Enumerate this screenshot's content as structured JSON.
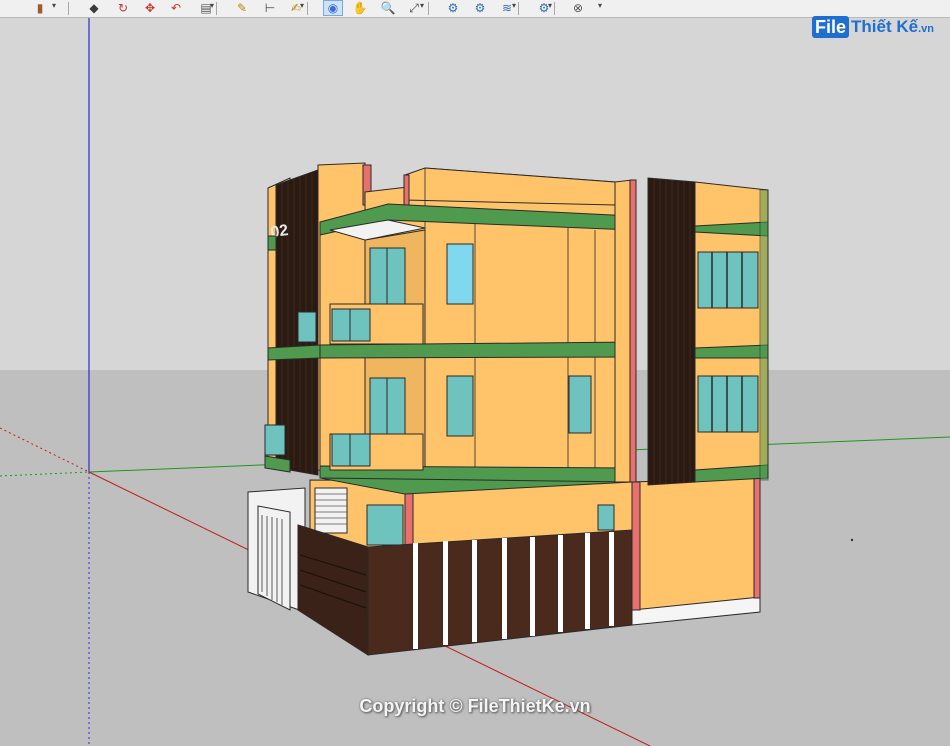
{
  "app": {
    "toolbar": {
      "tools": [
        {
          "name": "paint-bucket-tool-icon",
          "glyph": "▮",
          "color": "#a05a2c"
        },
        {
          "name": "eraser-tool-icon",
          "glyph": "◆",
          "color": "#3a3a3a"
        },
        {
          "name": "rotate-tool-icon",
          "glyph": "↻",
          "color": "#c0392b"
        },
        {
          "name": "move-tool-icon",
          "glyph": "✥",
          "color": "#c0392b"
        },
        {
          "name": "undo-icon",
          "glyph": "↶",
          "color": "#c0392b"
        },
        {
          "name": "offset-tool-icon",
          "glyph": "▤",
          "color": "#555555"
        },
        {
          "name": "tape-measure-icon",
          "glyph": "✎",
          "color": "#b8860b"
        },
        {
          "name": "dimension-tool-icon",
          "glyph": "⊢",
          "color": "#444444"
        },
        {
          "name": "text-tool-icon",
          "glyph": "✍",
          "color": "#b8860b"
        },
        {
          "name": "orbit-tool-icon",
          "glyph": "◉",
          "color": "#3a6fd0"
        },
        {
          "name": "pan-tool-icon",
          "glyph": "✋",
          "color": "#b8860b"
        },
        {
          "name": "zoom-tool-icon",
          "glyph": "🔍",
          "color": "#444444"
        },
        {
          "name": "zoom-extents-icon",
          "glyph": "⤢",
          "color": "#444444"
        },
        {
          "name": "geo-location-icon",
          "glyph": "⚙",
          "color": "#2c6db3"
        },
        {
          "name": "add-location-icon",
          "glyph": "⚙",
          "color": "#2c6db3"
        },
        {
          "name": "terrain-toggle-icon",
          "glyph": "≋",
          "color": "#2c6db3"
        },
        {
          "name": "photo-texture-icon",
          "glyph": "⚙",
          "color": "#2c6db3"
        },
        {
          "name": "extension-warehouse-icon",
          "glyph": "⊗",
          "color": "#555555"
        }
      ]
    }
  },
  "colors": {
    "sky": "#d6d6d6",
    "ground": "#bfbfbf",
    "axis_blue": "#2b2bd8",
    "axis_green": "#1a9a1a",
    "axis_red": "#c41a1a",
    "facade_orange": "#ffc36a",
    "facade_shadow": "#efb55f",
    "slab_green": "#4f9a4f",
    "accent_pink": "#e8706f",
    "dark_panel": "#2a1a12",
    "gate_brown": "#4a2a1c",
    "glass_teal": "#6fc3bf",
    "glass_blue": "#7fd8ee",
    "window_frame": "#2a2a2a",
    "white_wall": "#f2f2f2"
  },
  "model": {
    "sign_text": "02"
  },
  "watermark": {
    "logo_badge": "File",
    "logo_name": "Thiết Kế",
    "logo_tld": ".vn",
    "copyright": "Copyright © FileThietKe.vn"
  }
}
